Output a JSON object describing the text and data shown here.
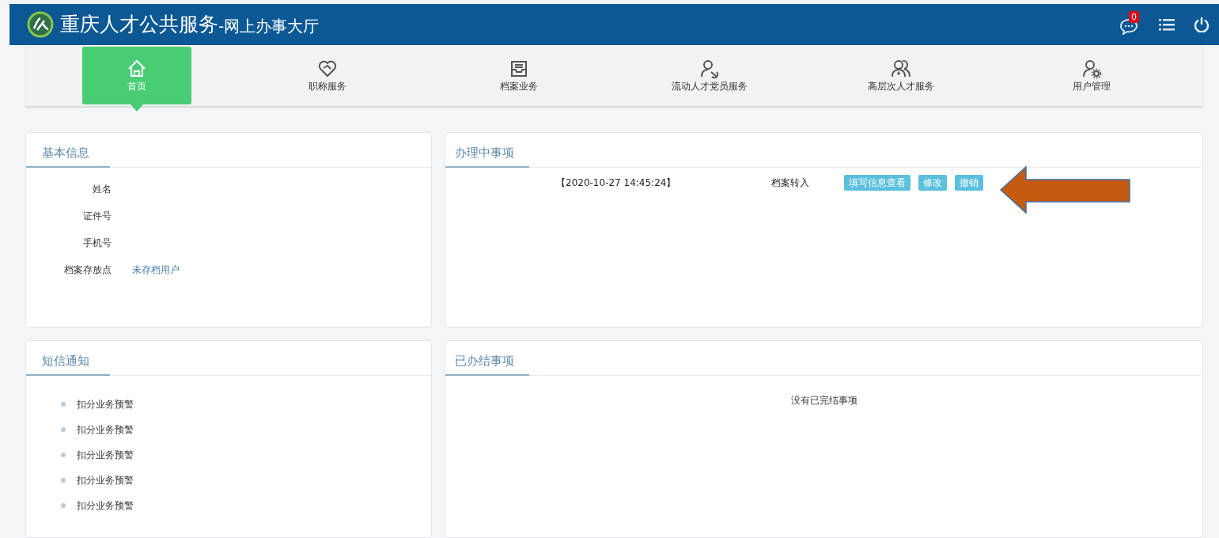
{
  "header": {
    "title": "重庆人才公共服务",
    "subtitle": "-网上办事大厅",
    "message_count": "0"
  },
  "nav": [
    {
      "label": "首页",
      "selected": true
    },
    {
      "label": "职称服务",
      "selected": false
    },
    {
      "label": "档案业务",
      "selected": false
    },
    {
      "label": "流动人才党员服务",
      "selected": false
    },
    {
      "label": "高层次人才服务",
      "selected": false
    },
    {
      "label": "用户管理",
      "selected": false
    }
  ],
  "basic_info": {
    "title": "基本信息",
    "fields": [
      {
        "label": "姓名"
      },
      {
        "label": "证件号"
      },
      {
        "label": "手机号"
      },
      {
        "label": "档案存放点",
        "value": "未存档用户"
      }
    ]
  },
  "in_progress": {
    "title": "办理中事项",
    "items": [
      {
        "time": "【2020-10-27 14:45:24】",
        "type": "档案转入",
        "actions": [
          "填写信息查看",
          "修改",
          "撤销"
        ]
      }
    ]
  },
  "sms": {
    "title": "短信通知",
    "items": [
      "扣分业务预警",
      "扣分业务预警",
      "扣分业务预警",
      "扣分业务预警",
      "扣分业务预警"
    ]
  },
  "completed": {
    "title": "已办结事项",
    "empty_text": "没有已完结事项"
  }
}
